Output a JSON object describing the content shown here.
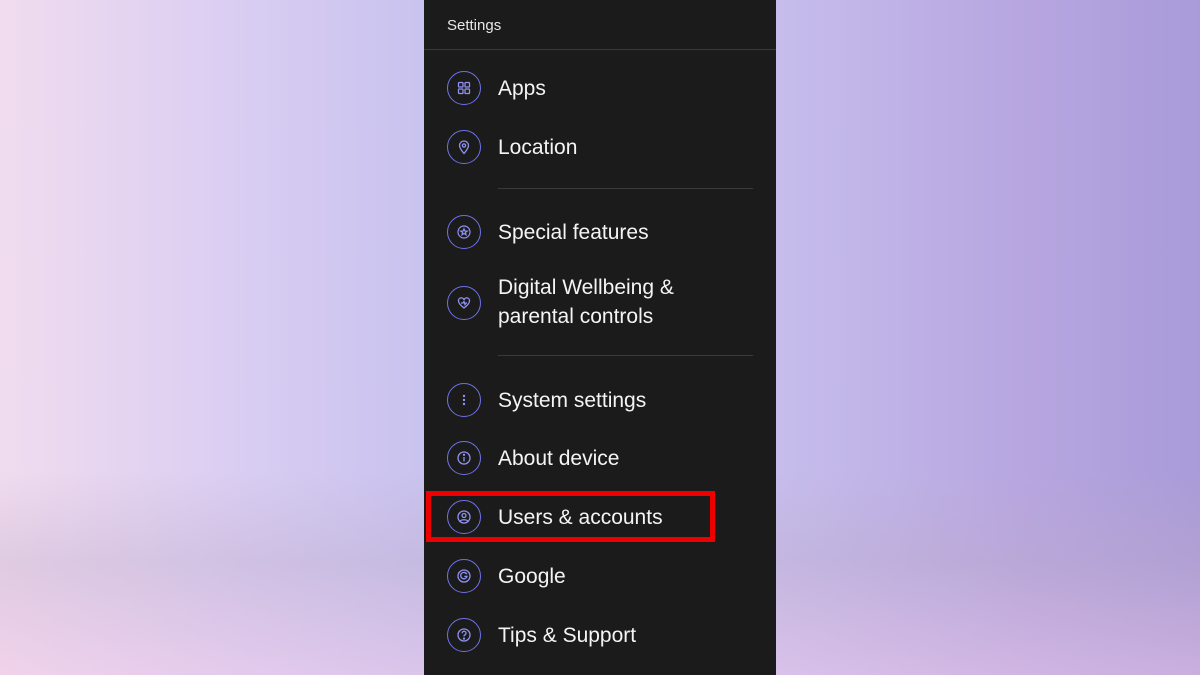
{
  "header": {
    "title": "Settings"
  },
  "items": [
    {
      "label": "Apps",
      "icon": "apps-grid-icon"
    },
    {
      "label": "Location",
      "icon": "location-pin-icon"
    },
    {
      "label": "Special features",
      "icon": "star-icon"
    },
    {
      "label": "Digital Wellbeing &",
      "label2": "parental controls",
      "icon": "heart-icon"
    },
    {
      "label": "System settings",
      "icon": "more-vertical-icon"
    },
    {
      "label": "About device",
      "icon": "info-icon"
    },
    {
      "label": "Users & accounts",
      "icon": "user-icon"
    },
    {
      "label": "Google",
      "icon": "google-icon"
    },
    {
      "label": "Tips & Support",
      "icon": "help-icon"
    }
  ],
  "colors": {
    "accent": "#6f72e8",
    "highlight": "#ee0000",
    "panel": "#1b1b1b"
  }
}
